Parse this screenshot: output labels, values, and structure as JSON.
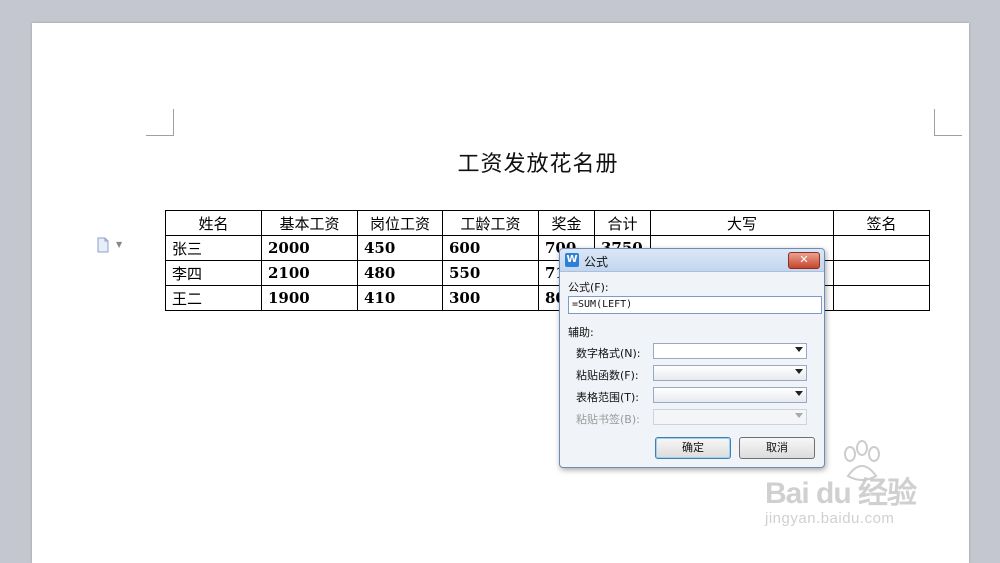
{
  "document": {
    "title": "工资发放花名册",
    "table": {
      "headers": [
        "姓名",
        "基本工资",
        "岗位工资",
        "工龄工资",
        "奖金",
        "合计",
        "大写",
        "签名"
      ],
      "rows": [
        {
          "name": "张三",
          "base": "2000",
          "post": "450",
          "seniority": "600",
          "bonus": "700",
          "total": "3750",
          "uppercase": "",
          "sign": ""
        },
        {
          "name": "李四",
          "base": "2100",
          "post": "480",
          "seniority": "550",
          "bonus": "71",
          "total": "",
          "uppercase": "",
          "sign": ""
        },
        {
          "name": "王二",
          "base": "1900",
          "post": "410",
          "seniority": "300",
          "bonus": "80",
          "total": "",
          "uppercase": "",
          "sign": ""
        }
      ]
    }
  },
  "dialog": {
    "app_icon_letter": "W",
    "title": "公式",
    "close_label": "✕",
    "formula_label": "公式(F):",
    "formula_value": "=SUM(LEFT)",
    "assist_label": "辅助:",
    "number_format_label": "数字格式(N):",
    "paste_function_label": "粘贴函数(F):",
    "table_range_label": "表格范围(T):",
    "paste_bookmark_label": "粘贴书签(B):",
    "ok_label": "确定",
    "cancel_label": "取消"
  },
  "watermark": {
    "brand": "Bai du 经验",
    "url": "jingyan.baidu.com"
  },
  "icons": {
    "paragraph": "document-icon",
    "dropdown": "chevron-down-icon"
  },
  "colors": {
    "workspace_bg": "#c4c7cf",
    "close_button": "#c8452c",
    "app_icon": "#2f7fd8"
  }
}
